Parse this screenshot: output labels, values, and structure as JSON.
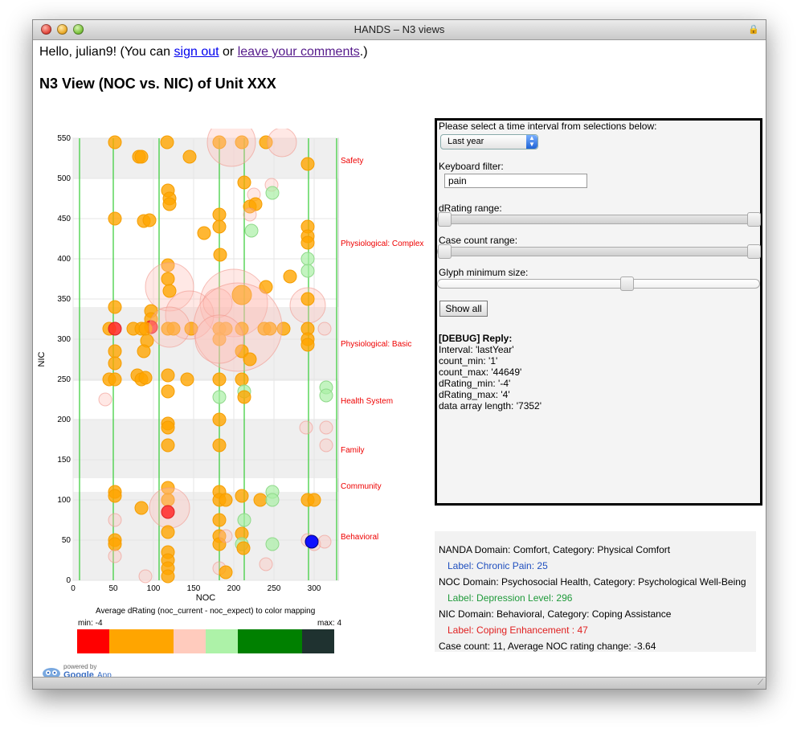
{
  "window": {
    "title": "HANDS – N3 views"
  },
  "greeting": {
    "prefix": "Hello, julian9! (You can",
    "sign_out": "sign out",
    "middle": "or",
    "comments": "leave your comments",
    "suffix": ".)"
  },
  "page_title": "N3 View (NOC vs. NIC) of Unit XXX",
  "chart_data": {
    "type": "scatter",
    "title": "",
    "xlabel": "NOC",
    "ylabel": "NIC",
    "xlim": [
      0,
      330
    ],
    "ylim": [
      0,
      550
    ],
    "xticks": [
      0,
      50,
      100,
      150,
      200,
      250,
      300
    ],
    "yticks": [
      0,
      50,
      100,
      150,
      200,
      250,
      300,
      350,
      400,
      450,
      500,
      550
    ],
    "vertical_lines": [
      8,
      50,
      107,
      182,
      213,
      293,
      328
    ],
    "bands": [
      {
        "label": "Safety",
        "from": 500,
        "to": 550,
        "y_label": 523
      },
      {
        "label": "Physiological: Complex",
        "from": 340,
        "to": 500,
        "y_label": 420
      },
      {
        "label": "Physiological: Basic",
        "from": 248,
        "to": 340,
        "y_label": 295
      },
      {
        "label": "Health System",
        "from": 200,
        "to": 248,
        "y_label": 224
      },
      {
        "label": "Family",
        "from": 127,
        "to": 200,
        "y_label": 163
      },
      {
        "label": "Community",
        "from": 110,
        "to": 127,
        "y_label": 118
      },
      {
        "label": "Behavioral",
        "from": 0,
        "to": 110,
        "y_label": 55
      }
    ],
    "points": [
      [
        52,
        545,
        8,
        "o"
      ],
      [
        82,
        527,
        8,
        "o"
      ],
      [
        85,
        527,
        8,
        "o"
      ],
      [
        117,
        545,
        8,
        "o"
      ],
      [
        145,
        527,
        8,
        "o"
      ],
      [
        182,
        545,
        8,
        "o"
      ],
      [
        210,
        545,
        8,
        "o"
      ],
      [
        240,
        545,
        8,
        "o"
      ],
      [
        292,
        518,
        8,
        "o"
      ],
      [
        197,
        545,
        30,
        "p"
      ],
      [
        260,
        545,
        18,
        "p"
      ],
      [
        118,
        485,
        8,
        "o"
      ],
      [
        120,
        475,
        8,
        "o"
      ],
      [
        120,
        468,
        8,
        "o"
      ],
      [
        213,
        495,
        8,
        "o"
      ],
      [
        225,
        480,
        8,
        "p"
      ],
      [
        247,
        492,
        8,
        "p"
      ],
      [
        248,
        482,
        8,
        "g"
      ],
      [
        220,
        465,
        8,
        "o"
      ],
      [
        227,
        468,
        8,
        "o"
      ],
      [
        52,
        450,
        8,
        "o"
      ],
      [
        88,
        447,
        8,
        "o"
      ],
      [
        95,
        448,
        8,
        "o"
      ],
      [
        182,
        455,
        8,
        "o"
      ],
      [
        182,
        440,
        8,
        "o"
      ],
      [
        220,
        455,
        8,
        "p"
      ],
      [
        222,
        435,
        8,
        "g"
      ],
      [
        292,
        440,
        8,
        "o"
      ],
      [
        292,
        428,
        8,
        "o"
      ],
      [
        292,
        420,
        8,
        "o"
      ],
      [
        292,
        400,
        8,
        "g"
      ],
      [
        292,
        385,
        8,
        "g"
      ],
      [
        163,
        432,
        8,
        "o"
      ],
      [
        183,
        405,
        8,
        "o"
      ],
      [
        270,
        378,
        8,
        "o"
      ],
      [
        118,
        392,
        8,
        "o"
      ],
      [
        120,
        365,
        30,
        "p"
      ],
      [
        200,
        345,
        42,
        "p"
      ],
      [
        145,
        330,
        30,
        "p"
      ],
      [
        180,
        345,
        18,
        "p"
      ],
      [
        210,
        355,
        12,
        "o"
      ],
      [
        240,
        365,
        8,
        "o"
      ],
      [
        292,
        342,
        22,
        "p"
      ],
      [
        292,
        350,
        8,
        "o"
      ],
      [
        52,
        340,
        8,
        "o"
      ],
      [
        118,
        375,
        8,
        "o"
      ],
      [
        120,
        360,
        8,
        "o"
      ],
      [
        97,
        335,
        8,
        "o"
      ],
      [
        97,
        325,
        8,
        "o"
      ],
      [
        97,
        315,
        8,
        "r"
      ],
      [
        45,
        313,
        8,
        "o"
      ],
      [
        52,
        313,
        8,
        "r"
      ],
      [
        75,
        313,
        8,
        "o"
      ],
      [
        85,
        313,
        8,
        "o"
      ],
      [
        90,
        313,
        8,
        "o"
      ],
      [
        118,
        313,
        8,
        "o"
      ],
      [
        125,
        313,
        8,
        "o"
      ],
      [
        147,
        313,
        8,
        "o"
      ],
      [
        182,
        313,
        8,
        "o"
      ],
      [
        182,
        300,
        8,
        "o"
      ],
      [
        190,
        313,
        8,
        "o"
      ],
      [
        210,
        313,
        8,
        "o"
      ],
      [
        238,
        313,
        8,
        "o"
      ],
      [
        245,
        313,
        8,
        "o"
      ],
      [
        262,
        313,
        8,
        "o"
      ],
      [
        292,
        313,
        8,
        "o"
      ],
      [
        292,
        300,
        8,
        "o"
      ],
      [
        292,
        293,
        8,
        "o"
      ],
      [
        313,
        313,
        8,
        "p"
      ],
      [
        205,
        315,
        55,
        "p"
      ],
      [
        120,
        315,
        25,
        "p"
      ],
      [
        92,
        298,
        8,
        "o"
      ],
      [
        88,
        285,
        8,
        "o"
      ],
      [
        52,
        285,
        8,
        "o"
      ],
      [
        52,
        270,
        8,
        "o"
      ],
      [
        210,
        285,
        8,
        "o"
      ],
      [
        220,
        275,
        8,
        "o"
      ],
      [
        182,
        300,
        30,
        "p"
      ],
      [
        45,
        250,
        8,
        "o"
      ],
      [
        52,
        250,
        8,
        "o"
      ],
      [
        80,
        255,
        8,
        "o"
      ],
      [
        85,
        250,
        8,
        "o"
      ],
      [
        90,
        252,
        8,
        "o"
      ],
      [
        118,
        255,
        8,
        "o"
      ],
      [
        142,
        250,
        8,
        "o"
      ],
      [
        182,
        250,
        8,
        "o"
      ],
      [
        210,
        250,
        8,
        "o"
      ],
      [
        213,
        235,
        8,
        "g"
      ],
      [
        315,
        240,
        8,
        "g"
      ],
      [
        315,
        230,
        8,
        "g"
      ],
      [
        40,
        225,
        8,
        "p"
      ],
      [
        118,
        235,
        8,
        "o"
      ],
      [
        182,
        228,
        8,
        "g"
      ],
      [
        213,
        228,
        8,
        "o"
      ],
      [
        118,
        195,
        8,
        "o"
      ],
      [
        118,
        190,
        8,
        "o"
      ],
      [
        182,
        200,
        8,
        "o"
      ],
      [
        290,
        190,
        8,
        "p"
      ],
      [
        315,
        190,
        8,
        "p"
      ],
      [
        118,
        168,
        8,
        "o"
      ],
      [
        182,
        168,
        8,
        "o"
      ],
      [
        315,
        168,
        8,
        "p"
      ],
      [
        52,
        110,
        8,
        "o"
      ],
      [
        52,
        105,
        8,
        "o"
      ],
      [
        118,
        115,
        8,
        "o"
      ],
      [
        118,
        100,
        8,
        "o"
      ],
      [
        120,
        90,
        25,
        "p"
      ],
      [
        118,
        85,
        8,
        "r"
      ],
      [
        85,
        90,
        8,
        "o"
      ],
      [
        182,
        110,
        8,
        "o"
      ],
      [
        182,
        100,
        8,
        "o"
      ],
      [
        190,
        100,
        8,
        "o"
      ],
      [
        210,
        105,
        8,
        "o"
      ],
      [
        233,
        100,
        8,
        "o"
      ],
      [
        248,
        110,
        8,
        "g"
      ],
      [
        248,
        100,
        8,
        "g"
      ],
      [
        213,
        75,
        8,
        "g"
      ],
      [
        52,
        75,
        8,
        "p"
      ],
      [
        118,
        60,
        8,
        "o"
      ],
      [
        182,
        75,
        8,
        "o"
      ],
      [
        210,
        58,
        8,
        "o"
      ],
      [
        292,
        100,
        8,
        "o"
      ],
      [
        300,
        100,
        8,
        "o"
      ],
      [
        52,
        50,
        8,
        "o"
      ],
      [
        52,
        45,
        8,
        "o"
      ],
      [
        118,
        35,
        8,
        "o"
      ],
      [
        118,
        25,
        8,
        "o"
      ],
      [
        118,
        15,
        8,
        "o"
      ],
      [
        182,
        55,
        8,
        "o"
      ],
      [
        182,
        45,
        8,
        "o"
      ],
      [
        190,
        55,
        8,
        "p"
      ],
      [
        210,
        45,
        8,
        "g"
      ],
      [
        212,
        40,
        8,
        "o"
      ],
      [
        248,
        45,
        8,
        "g"
      ],
      [
        292,
        50,
        8,
        "p"
      ],
      [
        300,
        45,
        8,
        "p"
      ],
      [
        313,
        48,
        8,
        "p"
      ],
      [
        297,
        48,
        8,
        "b"
      ],
      [
        90,
        5,
        8,
        "p"
      ],
      [
        118,
        5,
        8,
        "o"
      ],
      [
        182,
        15,
        8,
        "p"
      ],
      [
        190,
        10,
        8,
        "o"
      ],
      [
        52,
        30,
        8,
        "p"
      ],
      [
        240,
        20,
        8,
        "p"
      ]
    ]
  },
  "legend": {
    "title": "Average dRating (noc_current - noc_expect) to color mapping",
    "min": "min: -4",
    "max": "max: 4",
    "colors": [
      "#ff0000",
      "#ffa500",
      "#ffcbbd",
      "#adf2a8",
      "#008000",
      "#1f3230"
    ],
    "widths": [
      1,
      2,
      1,
      1,
      2,
      1
    ]
  },
  "appengine": {
    "powered": "powered by",
    "google": "Google",
    "engine": "App Engine"
  },
  "panel": {
    "interval_label": "Please select a time interval from selections below:",
    "interval_value": "Last year",
    "filter_label": "Keyboard filter:",
    "filter_value": "pain",
    "drating_label": "dRating range:",
    "drating_range": [
      0,
      1
    ],
    "casecount_label": "Case count range:",
    "casecount_range": [
      0,
      1
    ],
    "glyph_label": "Glyph minimum size:",
    "glyph_value": 0.59,
    "show_all": "Show all",
    "debug_title": "[DEBUG] Reply:",
    "debug_lines": [
      "Interval: 'lastYear'",
      "count_min: '1'",
      "count_max: '44649'",
      "dRating_min: '-4'",
      "dRating_max: '4'",
      "data array length: '7352'"
    ]
  },
  "info": {
    "nanda": "NANDA Domain: Comfort, Category: Physical Comfort",
    "nanda_label": "Label: Chronic Pain: 25",
    "noc": "NOC Domain: Psychosocial Health, Category: Psychological Well-Being",
    "noc_label": "Label: Depression Level: 296",
    "nic": "NIC Domain: Behavioral, Category: Coping Assistance",
    "nic_label": "Label: Coping Enhancement : 47",
    "summary": "Case count: 11, Average NOC rating change: -3.64"
  }
}
